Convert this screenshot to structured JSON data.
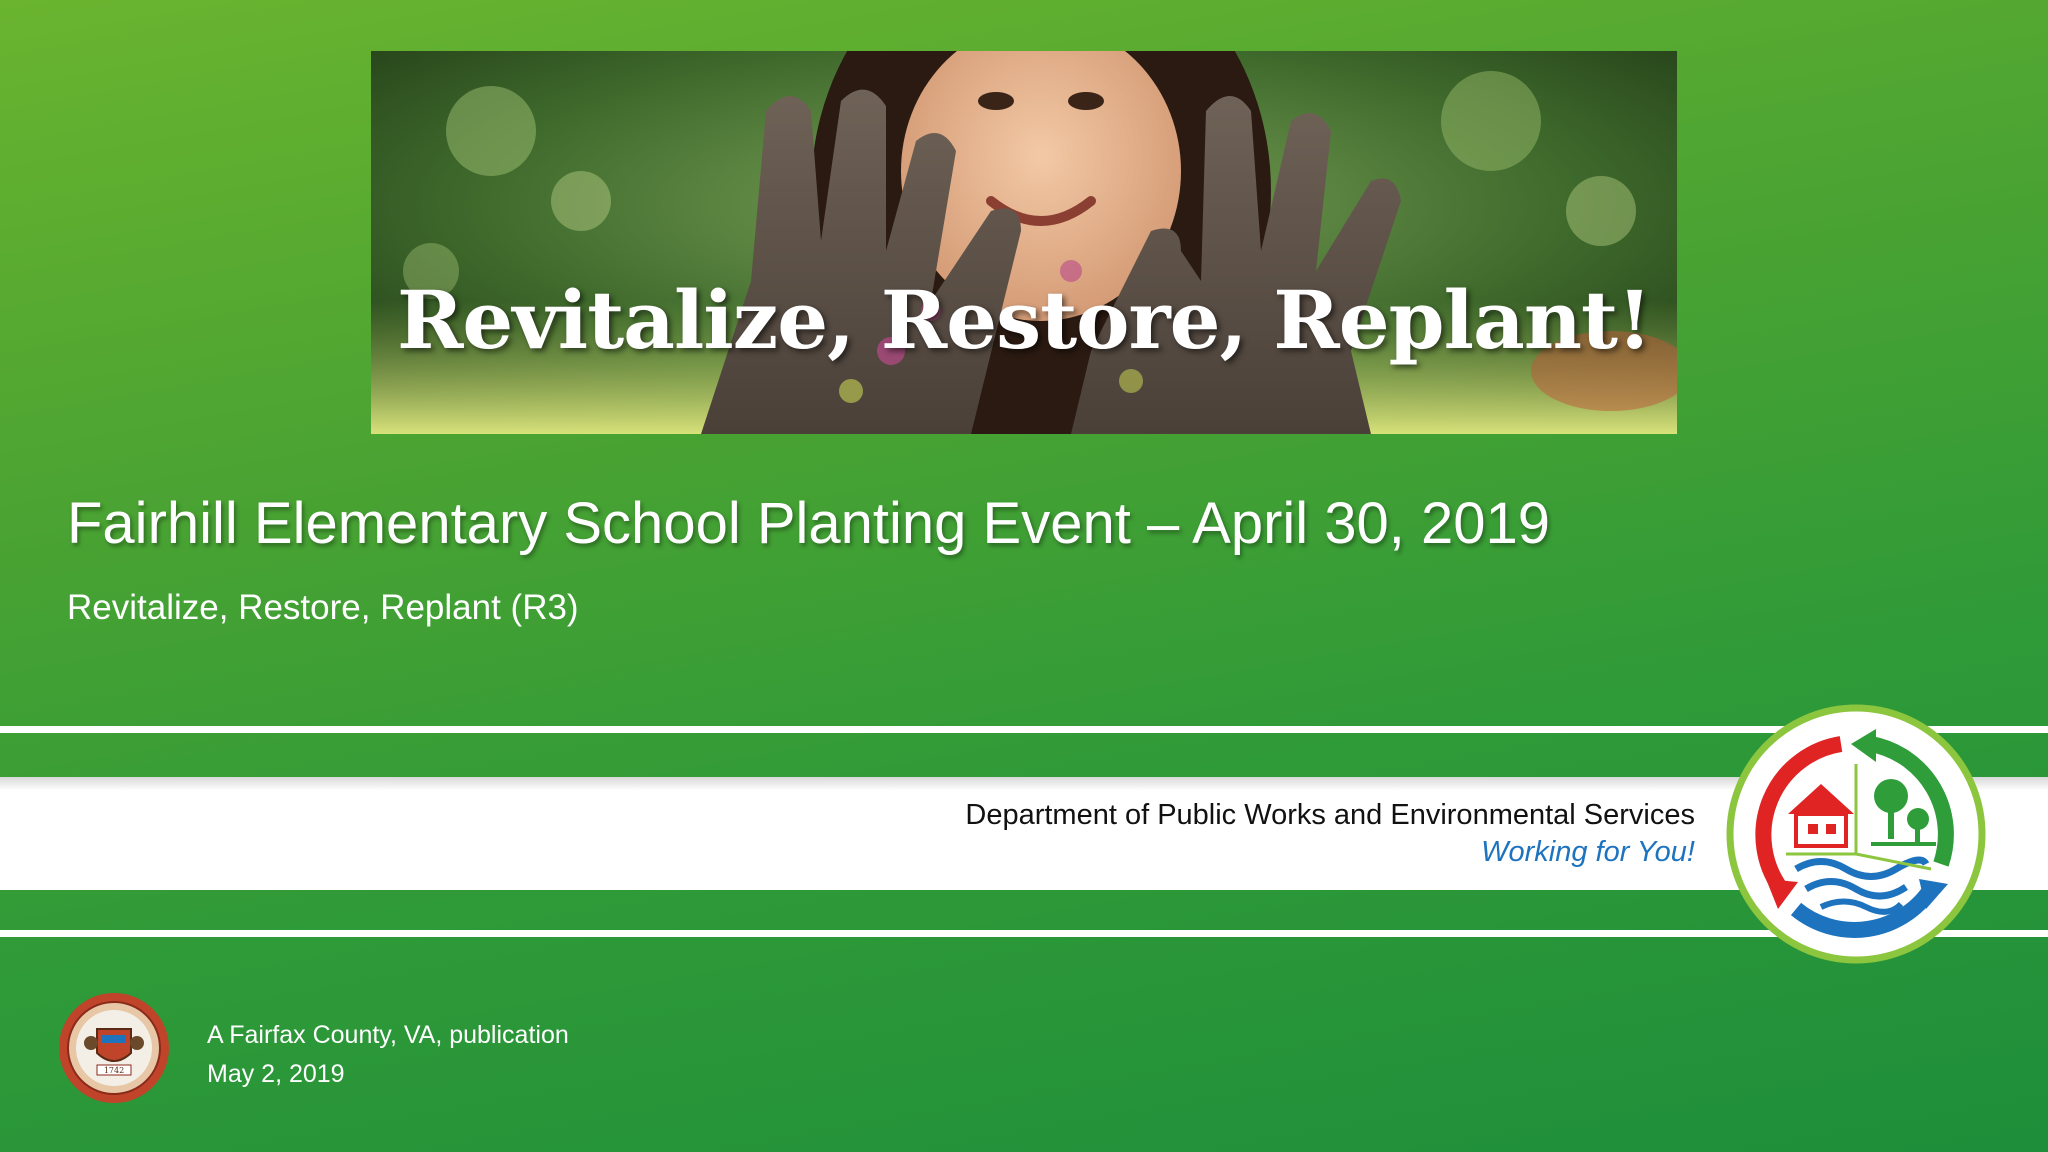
{
  "banner": {
    "headline": "Revitalize, Restore, Replant!"
  },
  "title": "Fairhill Elementary School Planting Event – April 30, 2019",
  "subtitle": "Revitalize, Restore, Replant (R3)",
  "department": {
    "name": "Department of Public Works and Environmental Services",
    "tagline": "Working for You!"
  },
  "seal": {
    "year": "1742"
  },
  "footer": {
    "publication": "A Fairfax County, VA, publication",
    "date": "May 2, 2019"
  },
  "colors": {
    "green_accent": "#8cc63f",
    "red_arrow": "#e02424",
    "green_arrow": "#2e9d3a",
    "blue_arrow": "#1e73be",
    "tagline_blue": "#1e73be"
  }
}
